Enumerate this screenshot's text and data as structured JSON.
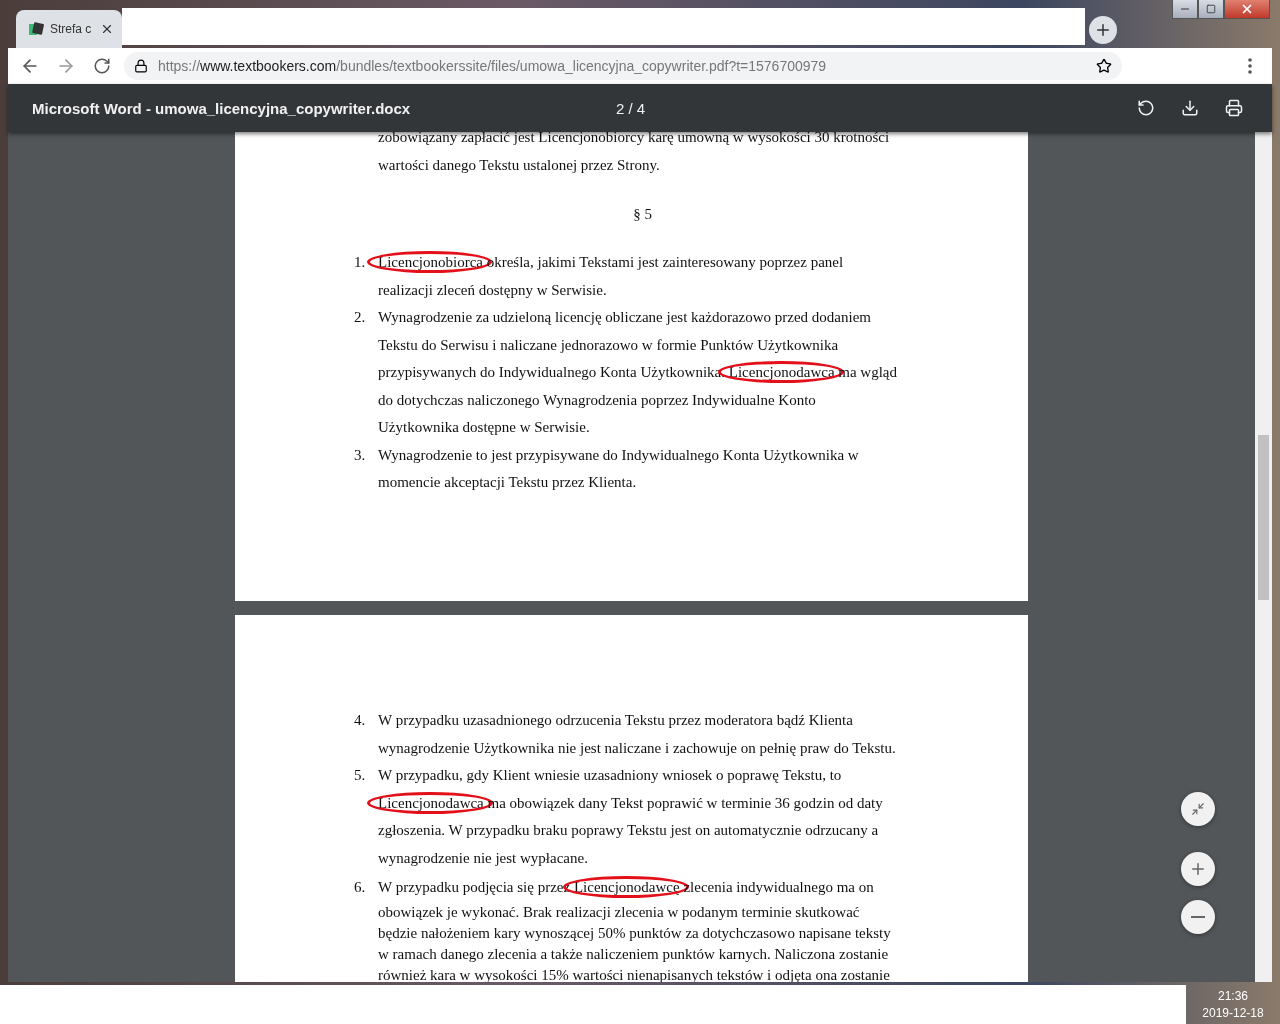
{
  "browser": {
    "tab": {
      "title": "Strefa c",
      "selected": true
    },
    "address": {
      "scheme": "https://",
      "host": "www.textbookers.com",
      "path": "/bundles/textbookerssite/files/umowa_licencyjna_copywriter.pdf?t=1576700979"
    }
  },
  "pdf_toolbar": {
    "title": "Microsoft Word - umowa_licencyjna_copywriter.docx",
    "page_indicator": "2 / 4"
  },
  "pages": [
    {
      "blocks": [
        {
          "kind": "continuation",
          "compact": false,
          "lines": [
            [
              {
                "text": "zobowiązany zapłacić jest Licencjonobiorcy karę umowną w wysokości 30 krotności",
                "circled": false
              }
            ],
            [
              {
                "text": "wartości danego Tekstu ustalonej przez Strony.",
                "circled": false
              }
            ]
          ]
        },
        {
          "kind": "heading",
          "text": "§ 5"
        },
        {
          "kind": "item",
          "number": "1.",
          "compact": false,
          "lines": [
            [
              {
                "text": "Licencjonobiorca",
                "circled": true
              },
              {
                "text": " określa, jakimi Tekstami jest zainteresowany poprzez panel",
                "circled": false
              }
            ],
            [
              {
                "text": "realizacji zleceń dostępny w Serwisie.",
                "circled": false
              }
            ]
          ]
        },
        {
          "kind": "item",
          "number": "2.",
          "compact": false,
          "lines": [
            [
              {
                "text": "Wynagrodzenie za udzieloną licencję obliczane jest każdorazowo przed dodaniem",
                "circled": false
              }
            ],
            [
              {
                "text": "Tekstu do Serwisu i naliczane jednorazowo w formie Punktów Użytkownika",
                "circled": false
              }
            ],
            [
              {
                "text": "przypisywanych do Indywidualnego Konta Użytkownika. ",
                "circled": false
              },
              {
                "text": "Licencjonodawca",
                "circled": true
              },
              {
                "text": " ma wgląd",
                "circled": false
              }
            ],
            [
              {
                "text": "do dotychczas naliczonego Wynagrodzenia poprzez Indywidualne Konto",
                "circled": false
              }
            ],
            [
              {
                "text": "Użytkownika dostępne w Serwisie.",
                "circled": false
              }
            ]
          ]
        },
        {
          "kind": "item",
          "number": "3.",
          "compact": false,
          "lines": [
            [
              {
                "text": "Wynagrodzenie to jest przypisywane do Indywidualnego Konta Użytkownika w",
                "circled": false
              }
            ],
            [
              {
                "text": "momencie akceptacji Tekstu przez Klienta.",
                "circled": false
              }
            ]
          ]
        }
      ]
    },
    {
      "blocks": [
        {
          "kind": "item",
          "number": "4.",
          "compact": false,
          "lines": [
            [
              {
                "text": "W przypadku uzasadnionego odrzucenia Tekstu przez moderatora bądź Klienta",
                "circled": false
              }
            ],
            [
              {
                "text": "wynagrodzenie Użytkownika nie jest naliczane i zachowuje on pełnię praw do Tekstu.",
                "circled": false
              }
            ]
          ]
        },
        {
          "kind": "item",
          "number": "5.",
          "compact": false,
          "lines": [
            [
              {
                "text": "W przypadku, gdy Klient wniesie uzasadniony wniosek o poprawę Tekstu, to",
                "circled": false
              }
            ],
            [
              {
                "text": "Licencjonodawca",
                "circled": true
              },
              {
                "text": " ma obowiązek dany Tekst poprawić w terminie 36 godzin od daty",
                "circled": false
              }
            ],
            [
              {
                "text": "zgłoszenia. W przypadku braku poprawy Tekstu jest on automatycznie odrzucany a",
                "circled": false
              }
            ],
            [
              {
                "text": "wynagrodzenie nie jest wypłacane.",
                "circled": false
              }
            ]
          ]
        },
        {
          "kind": "item",
          "number": "6.",
          "compact": true,
          "lines": [
            [
              {
                "text": "W przypadku podjęcia się przez ",
                "circled": false
              },
              {
                "text": "Licencjonodawcę",
                "circled": true
              },
              {
                "text": " zlecenia indywidualnego ma on",
                "circled": false
              }
            ],
            [
              {
                "text": "obowiązek je wykonać. Brak realizacji zlecenia w podanym terminie skutkować",
                "circled": false
              }
            ],
            [
              {
                "text": "będzie nałożeniem kary wynoszącej 50% punktów za dotychczasowo napisane teksty",
                "circled": false
              }
            ],
            [
              {
                "text": "w ramach danego zlecenia a także naliczeniem punktów karnych. Naliczona zostanie",
                "circled": false
              }
            ],
            [
              {
                "text": "również kara w wysokości 15% wartości nienapisanych tekstów i odjęta ona zostanie",
                "circled": false
              }
            ]
          ]
        }
      ]
    }
  ],
  "taskbar": {
    "time": "21:36",
    "date": "2019-12-18"
  }
}
